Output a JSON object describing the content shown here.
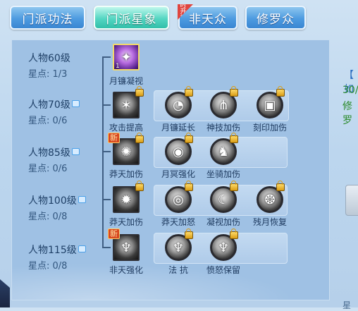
{
  "tabs": [
    {
      "label": "门派功法",
      "state": "normal"
    },
    {
      "label": "门派星象",
      "state": "active"
    },
    {
      "label": "非天众",
      "state": "normal",
      "badge": "限时开放"
    },
    {
      "label": "修罗众",
      "state": "normal"
    }
  ],
  "tiers": [
    {
      "level": "人物60级",
      "stars": "星点: 1/3",
      "locked": false
    },
    {
      "level": "人物70级",
      "stars": "星点: 0/6",
      "locked": true
    },
    {
      "level": "人物85级",
      "stars": "星点: 0/6",
      "locked": true
    },
    {
      "level": "人物100级",
      "stars": "星点: 0/8",
      "locked": true
    },
    {
      "level": "人物115级",
      "stars": "星点: 0/8",
      "locked": true
    }
  ],
  "skills": {
    "r0": [
      {
        "name": "月镰凝视",
        "count": "1",
        "style": "purple"
      }
    ],
    "r1": [
      {
        "name": "攻击提高",
        "style": "square"
      },
      {
        "name": "月镰延长",
        "style": "round"
      },
      {
        "name": "神技加伤",
        "style": "round"
      },
      {
        "name": "刻印加伤",
        "style": "round"
      }
    ],
    "r2": [
      {
        "name": "莽天加伤",
        "style": "square",
        "new": "新"
      },
      {
        "name": "月冥强化",
        "style": "round"
      },
      {
        "name": "坐骑加伤",
        "style": "round"
      }
    ],
    "r3": [
      {
        "name": "莽天加伤",
        "style": "square"
      },
      {
        "name": "莽天加怒",
        "style": "round"
      },
      {
        "name": "凝视加伤",
        "style": "round"
      },
      {
        "name": "残月恢复",
        "style": "round"
      }
    ],
    "r4": [
      {
        "name": "非天强化",
        "style": "square",
        "new": "新"
      },
      {
        "name": "法 抗",
        "style": "round"
      },
      {
        "name": "愤怒保留",
        "style": "round"
      }
    ]
  },
  "side": {
    "bracket": "【 如",
    "count": "30/",
    "text": "修罗",
    "bottom": "星"
  },
  "colors": {
    "accent_active": "#31bfa9",
    "tab_blue": "#3a86d2",
    "panel": "#9fc1e4"
  }
}
